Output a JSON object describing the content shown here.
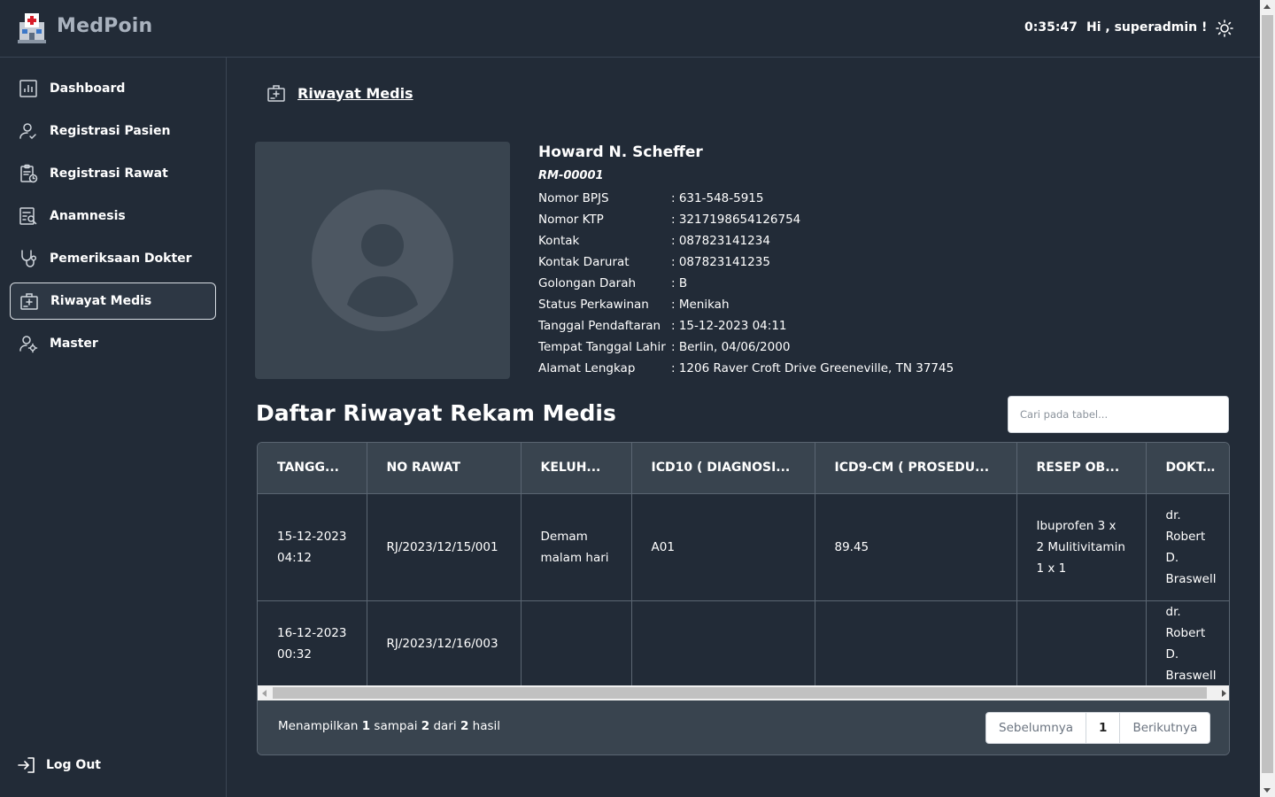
{
  "header": {
    "brand": "MedPoin",
    "clock": "0:35:47",
    "greeting": "Hi , superadmin !"
  },
  "sidebar": {
    "items": [
      {
        "label": "Dashboard",
        "icon": "chart-icon",
        "active": false
      },
      {
        "label": "Registrasi Pasien",
        "icon": "user-check-icon",
        "active": false
      },
      {
        "label": "Registrasi Rawat",
        "icon": "clipboard-clock-icon",
        "active": false
      },
      {
        "label": "Anamnesis",
        "icon": "document-search-icon",
        "active": false
      },
      {
        "label": "Pemeriksaan Dokter",
        "icon": "stethoscope-icon",
        "active": false
      },
      {
        "label": "Riwayat Medis",
        "icon": "medical-kit-icon",
        "active": true
      },
      {
        "label": "Master",
        "icon": "user-gear-icon",
        "active": false
      }
    ],
    "logout": "Log Out"
  },
  "breadcrumb": {
    "label": "Riwayat Medis"
  },
  "patient": {
    "name": "Howard N. Scheffer",
    "rm": "RM-00001",
    "fields": [
      {
        "label": "Nomor BPJS",
        "value": ": 631-548-5915"
      },
      {
        "label": "Nomor KTP",
        "value": ": 3217198654126754"
      },
      {
        "label": "Kontak",
        "value": ": 087823141234"
      },
      {
        "label": "Kontak Darurat",
        "value": ": 087823141235"
      },
      {
        "label": "Golongan Darah",
        "value": ": B"
      },
      {
        "label": "Status Perkawinan",
        "value": ": Menikah"
      },
      {
        "label": "Tanggal Pendaftaran",
        "value": ": 15-12-2023 04:11"
      },
      {
        "label": "Tempat Tanggal Lahir",
        "value": ": Berlin, 04/06/2000"
      },
      {
        "label": "Alamat Lengkap",
        "value": ": 1206 Raver Croft Drive Greeneville, TN 37745"
      }
    ]
  },
  "records": {
    "title": "Daftar Riwayat Rekam Medis",
    "search_placeholder": "Cari pada tabel...",
    "columns": [
      "TANGG...",
      "NO RAWAT",
      "KELUH...",
      "ICD10 ( DIAGNOSI...",
      "ICD9-CM ( PROSEDU...",
      "RESEP OB...",
      "DOKT..."
    ],
    "rows": [
      {
        "tanggal": "15-12-2023 04:12",
        "no_rawat": "RJ/2023/12/15/001",
        "keluhan": "Demam malam hari",
        "icd10": "A01",
        "icd9": "89.45",
        "resep": "Ibuprofen 3 x 2 Mulitivitamin 1 x 1",
        "dokter": "dr. Robert D. Braswell"
      },
      {
        "tanggal": "16-12-2023 00:32",
        "no_rawat": "RJ/2023/12/16/003",
        "keluhan": "",
        "icd10": "",
        "icd9": "",
        "resep": "",
        "dokter": "dr. Robert D. Braswell"
      }
    ],
    "summary": {
      "prefix": "Menampilkan",
      "from": "1",
      "mid1": "sampai",
      "to": "2",
      "mid2": "dari",
      "total": "2",
      "suffix": "hasil"
    },
    "pager": {
      "prev": "Sebelumnya",
      "current": "1",
      "next": "Berikutnya"
    }
  }
}
